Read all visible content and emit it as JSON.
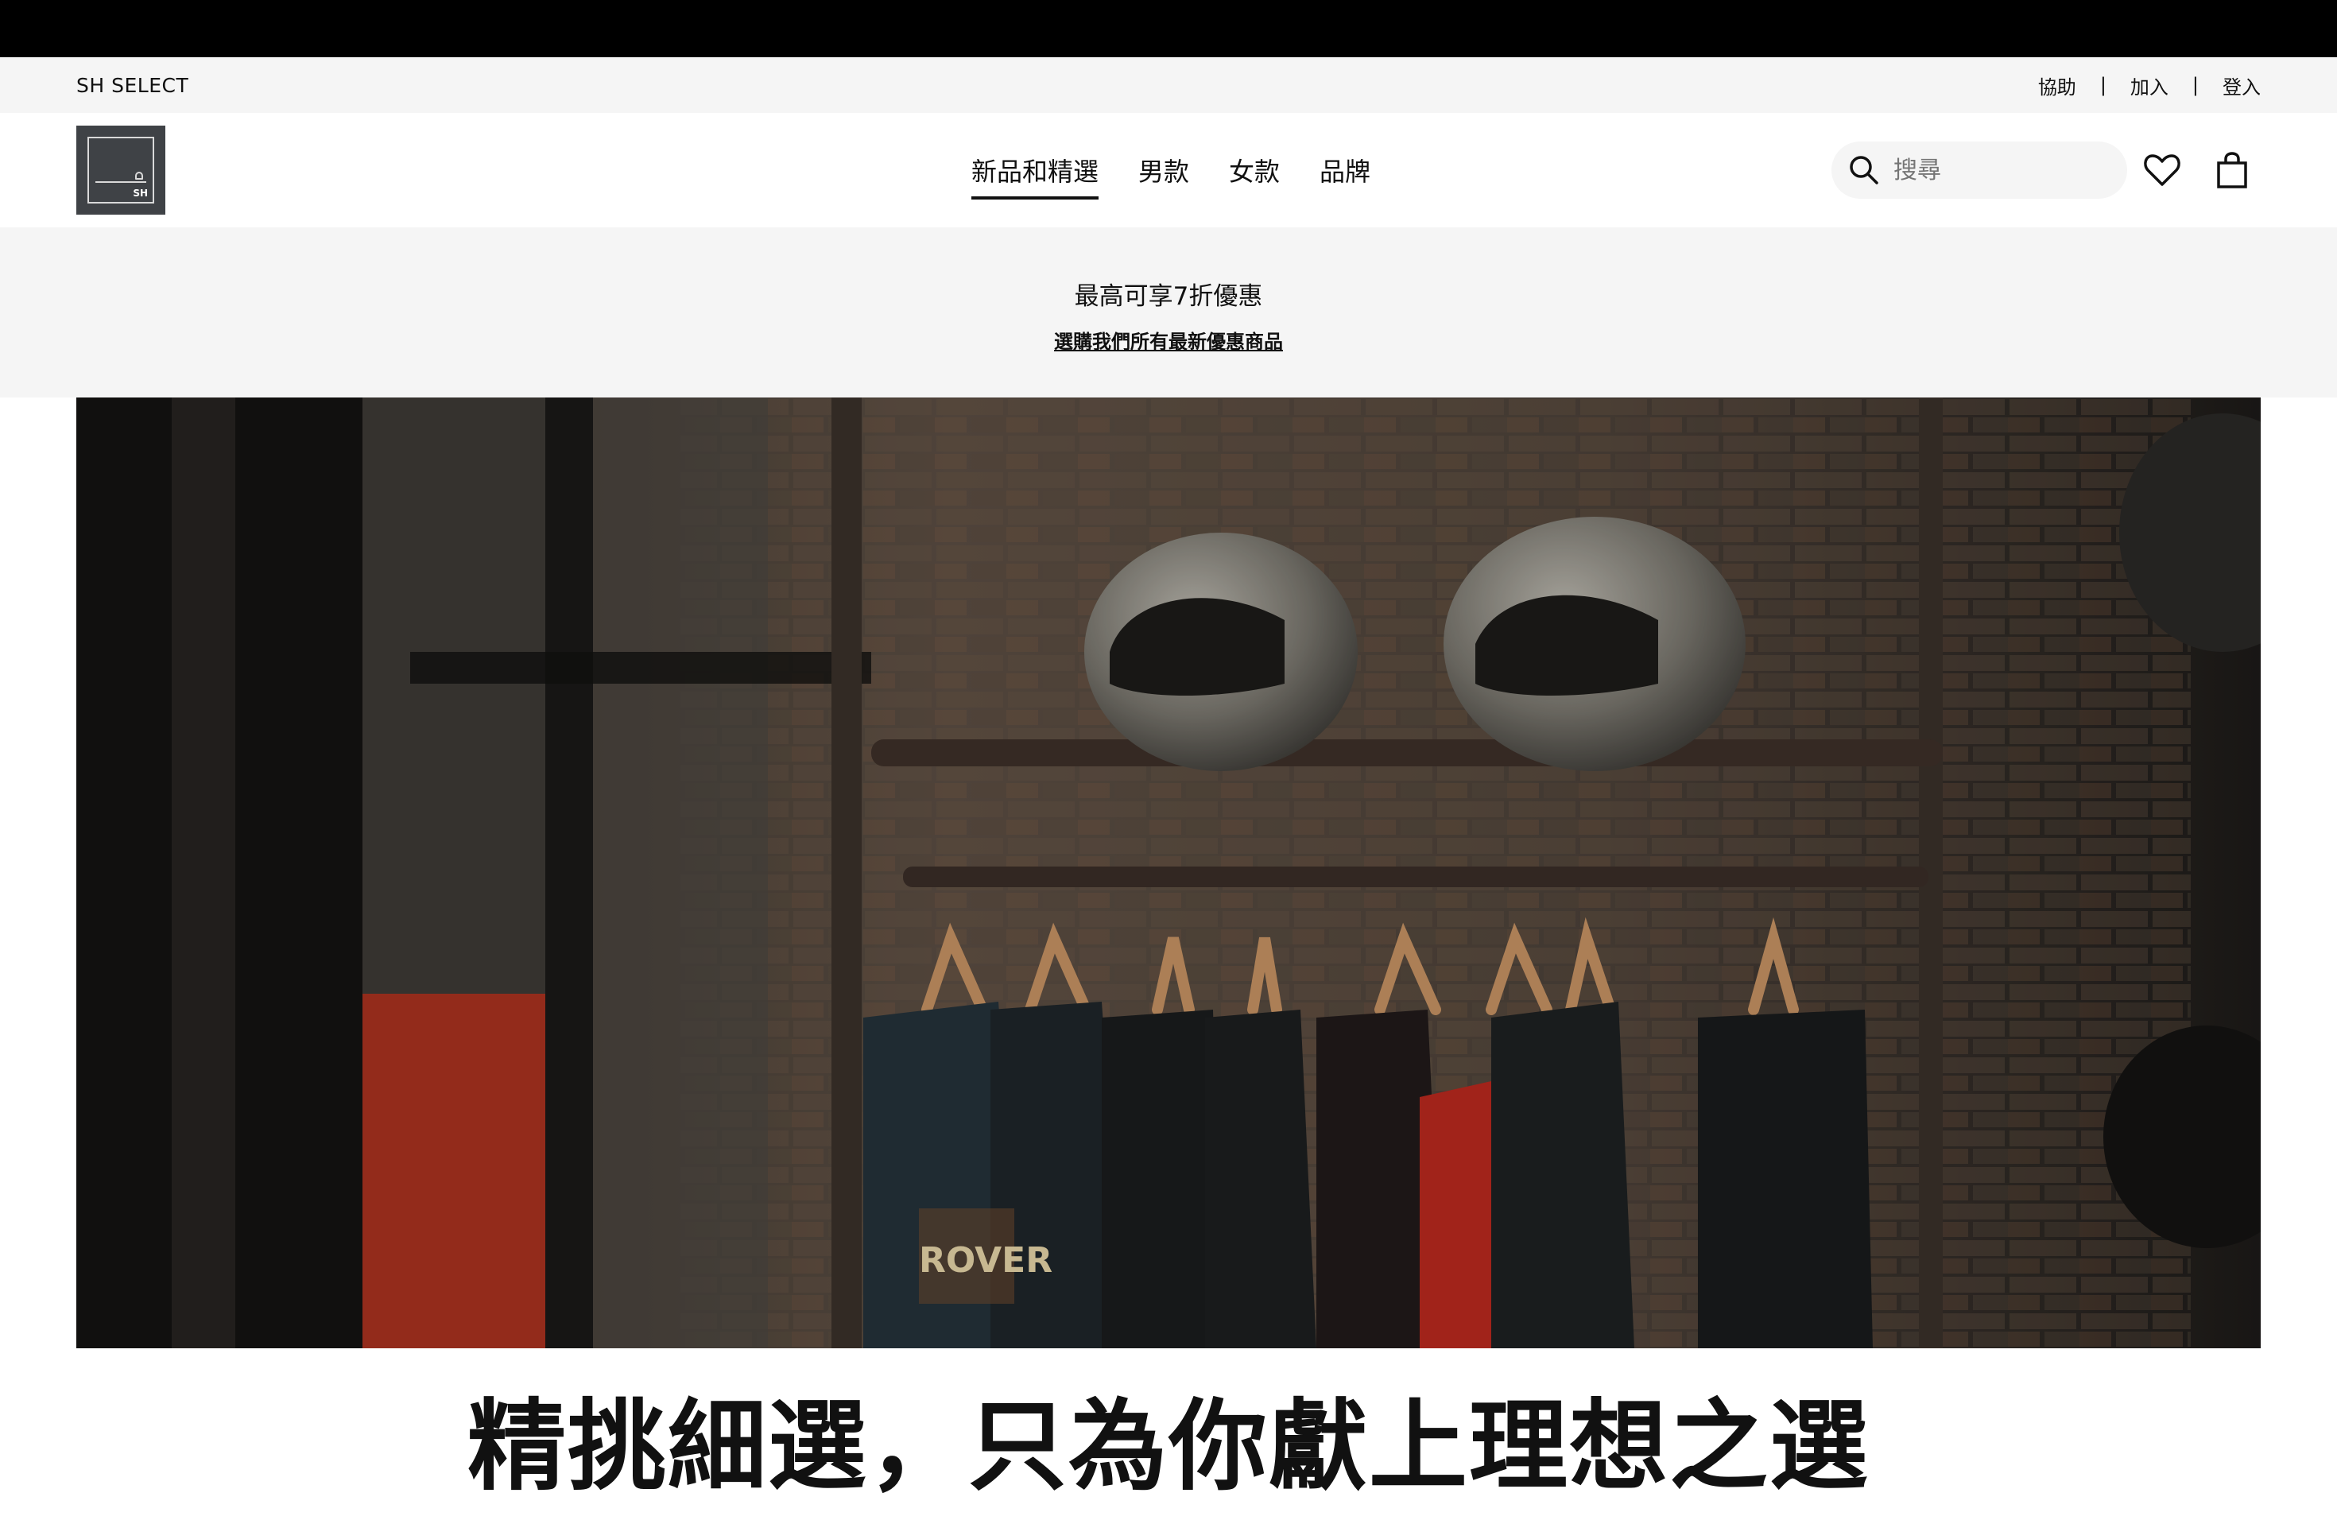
{
  "utility_bar": {
    "brand": "SH SELECT",
    "links": [
      "協助",
      "加入",
      "登入"
    ],
    "separator": "|"
  },
  "header": {
    "logo_text": "SH",
    "nav": [
      {
        "label": "新品和精選",
        "active": true
      },
      {
        "label": "男款",
        "active": false
      },
      {
        "label": "女款",
        "active": false
      },
      {
        "label": "品牌",
        "active": false
      }
    ],
    "search_placeholder": "搜尋",
    "icons": [
      "search-icon",
      "heart-icon",
      "shopping-bag-icon"
    ]
  },
  "promo": {
    "title": "最高可享7折優惠",
    "link": "選購我們所有最新優惠商品"
  },
  "hero": {
    "image_subject": "helmets and t-shirts on a rack against a brick wall",
    "shirt_print": "ROVER"
  },
  "headline": "精挑細選，只為你獻上理想之選",
  "colors": {
    "top_bar": "#000000",
    "utility_bg": "#f5f5f5",
    "logo_bg": "#3f4246",
    "text": "#111111"
  }
}
